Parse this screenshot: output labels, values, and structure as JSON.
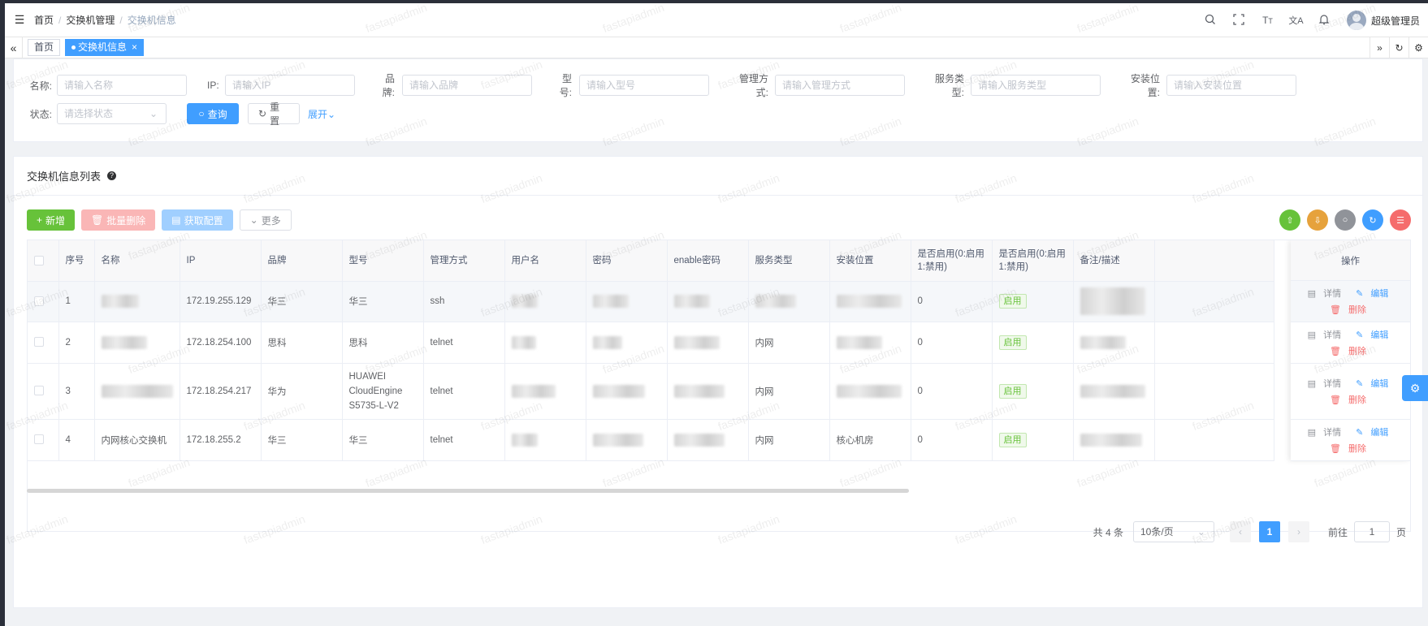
{
  "nav": {
    "breadcrumb": [
      "首页",
      "交换机管理",
      "交换机信息"
    ],
    "username": "超级管理员"
  },
  "tags": {
    "home": "首页",
    "current": "交换机信息"
  },
  "search": {
    "fields": [
      {
        "label": "名称:",
        "placeholder": "请输入名称"
      },
      {
        "label": "IP:",
        "placeholder": "请输入IP"
      },
      {
        "label": "品牌:",
        "placeholder": "请输入品牌"
      },
      {
        "label": "型号:",
        "placeholder": "请输入型号"
      },
      {
        "label": "管理方式:",
        "placeholder": "请输入管理方式"
      },
      {
        "label": "服务类型:",
        "placeholder": "请输入服务类型"
      },
      {
        "label": "安装位置:",
        "placeholder": "请输入安装位置"
      }
    ],
    "status": {
      "label": "状态:",
      "placeholder": "请选择状态"
    },
    "query": "查询",
    "reset": "重置",
    "expand": "展开"
  },
  "list": {
    "title": "交换机信息列表",
    "toolbar": {
      "add": "新增",
      "batch_delete": "批量删除",
      "fetch_config": "获取配置",
      "more": "更多"
    },
    "columns": [
      "序号",
      "名称",
      "IP",
      "品牌",
      "型号",
      "管理方式",
      "用户名",
      "密码",
      "enable密码",
      "服务类型",
      "安装位置",
      "是否启用(0:启用1:禁用)",
      "是否启用(0:启用1:禁用)",
      "备注/描述",
      "操作"
    ],
    "rows": [
      {
        "no": "1",
        "ip": "172.19.255.129",
        "brand": "华三",
        "model": "华三",
        "mgmt": "ssh",
        "service": "",
        "location": "",
        "enabled": "0",
        "status": "启用"
      },
      {
        "no": "2",
        "ip": "172.18.254.100",
        "brand": "思科",
        "model": "思科",
        "mgmt": "telnet",
        "service": "内网",
        "location": "",
        "enabled": "0",
        "status": "启用"
      },
      {
        "no": "3",
        "ip": "172.18.254.217",
        "brand": "华为",
        "model": "HUAWEI CloudEngine S5735-L-V2",
        "mgmt": "telnet",
        "service": "内网",
        "location": "",
        "enabled": "0",
        "status": "启用"
      },
      {
        "no": "4",
        "name": "内网核心交换机",
        "ip": "172.18.255.2",
        "brand": "华三",
        "model": "华三",
        "mgmt": "telnet",
        "service": "内网",
        "location": "核心机房",
        "enabled": "0",
        "status": "启用"
      }
    ],
    "ops": {
      "detail": "详情",
      "edit": "编辑",
      "delete": "删除"
    }
  },
  "pagination": {
    "total": "共 4 条",
    "page_size": "10条/页",
    "current": "1",
    "goto_label": "前往",
    "goto_value": "1",
    "page_suffix": "页"
  },
  "watermark": "fastapiadmin",
  "colors": {
    "primary": "#409eff",
    "success": "#67c23a",
    "danger": "#f56c6c",
    "warning": "#e6a23c"
  }
}
